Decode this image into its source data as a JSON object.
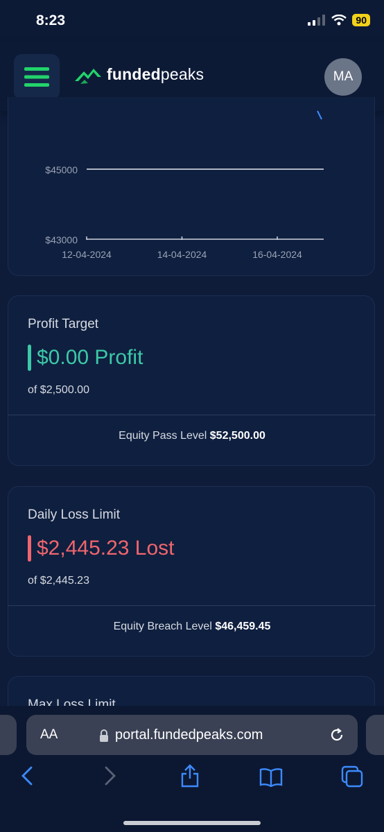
{
  "status": {
    "time": "8:23",
    "battery": "90"
  },
  "header": {
    "logo_bold": "funded",
    "logo_light": "peaks",
    "avatar_initials": "MA",
    "colors": {
      "accent": "#22d36a",
      "bar": "#0d1a36"
    }
  },
  "chart_data": {
    "type": "line",
    "y_tick_labels": [
      "$45000",
      "$43000"
    ],
    "x_tick_labels": [
      "12-04-2024",
      "14-04-2024",
      "16-04-2024"
    ],
    "series": [
      {
        "x": [
          "12-04-2024",
          "16-04-2024"
        ],
        "y": [
          45000,
          45000
        ]
      }
    ],
    "title": "",
    "xlabel": "",
    "ylabel": "",
    "grid": false
  },
  "profit_target": {
    "title": "Profit Target",
    "value": "$0.00 Profit",
    "of": "of $2,500.00",
    "footer_label": "Equity Pass Level",
    "footer_value": "$52,500.00",
    "color": "#3cc9a8"
  },
  "daily_loss": {
    "title": "Daily Loss Limit",
    "value": "$2,445.23 Lost",
    "of": "of $2,445.23",
    "footer_label": "Equity Breach Level",
    "footer_value": "$46,459.45",
    "color": "#f0666e"
  },
  "max_loss": {
    "title": "Max Loss Limit"
  },
  "browser": {
    "aa": "AA",
    "url": "portal.fundedpeaks.com"
  },
  "icons": [
    "menu-icon",
    "logo-icon",
    "cellular-icon",
    "wifi-icon",
    "lock-icon",
    "reload-icon",
    "back-icon",
    "forward-icon",
    "share-icon",
    "bookmarks-icon",
    "tabs-icon"
  ]
}
